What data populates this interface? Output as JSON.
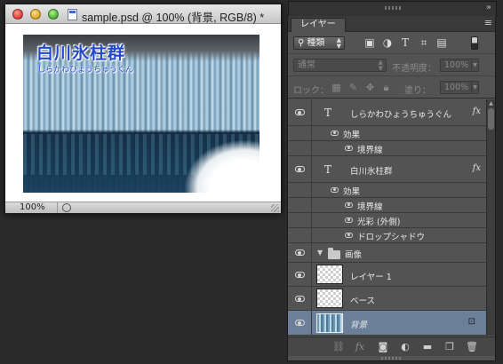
{
  "document": {
    "title": "sample.psd @ 100% (背景, RGB/8) *",
    "overlay_title": "白川氷柱群",
    "overlay_subtitle": "しらかわひょうちゅうぐん",
    "zoom": "100%"
  },
  "panel": {
    "tab_label": "レイヤー",
    "filter": {
      "kind_label": "種類",
      "icons": [
        "image-filter-icon",
        "adjustment-filter-icon",
        "type-filter-icon",
        "shape-filter-icon",
        "smart-object-filter-icon"
      ]
    },
    "blend_mode": "通常",
    "opacity_label": "不透明度：",
    "opacity_value": "100%",
    "lock_label": "ロック：",
    "fill_label": "塗り：",
    "fill_value": "100%"
  },
  "layers": [
    {
      "name": "しらかわひょうちゅうぐん",
      "kind": "text",
      "fx": "fx"
    },
    {
      "name": "効果",
      "kind": "effects-header"
    },
    {
      "name": "境界線",
      "kind": "effect"
    },
    {
      "name": "白川氷柱群",
      "kind": "text",
      "fx": "fx"
    },
    {
      "name": "効果",
      "kind": "effects-header"
    },
    {
      "name": "境界線",
      "kind": "effect"
    },
    {
      "name": "光彩 (外側)",
      "kind": "effect"
    },
    {
      "name": "ドロップシャドウ",
      "kind": "effect"
    },
    {
      "name": "画像",
      "kind": "group"
    },
    {
      "name": "レイヤー 1",
      "kind": "pixel"
    },
    {
      "name": "ベース",
      "kind": "pixel"
    },
    {
      "name": "背景",
      "kind": "background",
      "selected": true
    }
  ],
  "colors": {
    "panel_bg": "#535353",
    "selected_row": "#6b7f99",
    "overlay_text": "#2348c9"
  }
}
